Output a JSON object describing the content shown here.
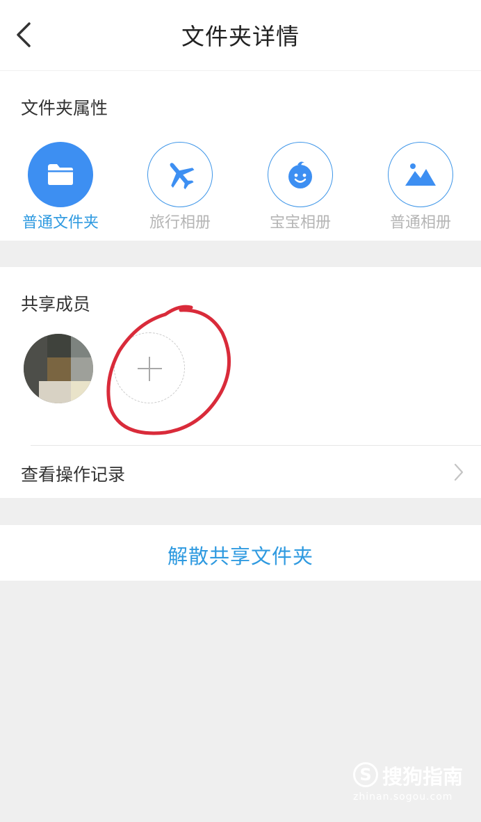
{
  "header": {
    "title": "文件夹详情",
    "back_icon": "chevron-left-icon"
  },
  "properties": {
    "section_title": "文件夹属性",
    "types": [
      {
        "label": "普通文件夹",
        "icon": "folder-icon",
        "selected": true
      },
      {
        "label": "旅行相册",
        "icon": "airplane-icon",
        "selected": false
      },
      {
        "label": "宝宝相册",
        "icon": "baby-face-icon",
        "selected": false
      },
      {
        "label": "普通相册",
        "icon": "mountain-photo-icon",
        "selected": false
      }
    ]
  },
  "members": {
    "section_title": "共享成员",
    "add_icon": "plus-icon",
    "log_label": "查看操作记录"
  },
  "actions": {
    "dissolve_label": "解散共享文件夹"
  },
  "watermark": {
    "logo_letter": "S",
    "brand": "搜狗指南",
    "url": "zhinan.sogou.com"
  },
  "colors": {
    "accent": "#2f9ae0",
    "icon_blue": "#3d8ff2",
    "annotation_red": "#d92b3a",
    "background": "#efefef"
  }
}
